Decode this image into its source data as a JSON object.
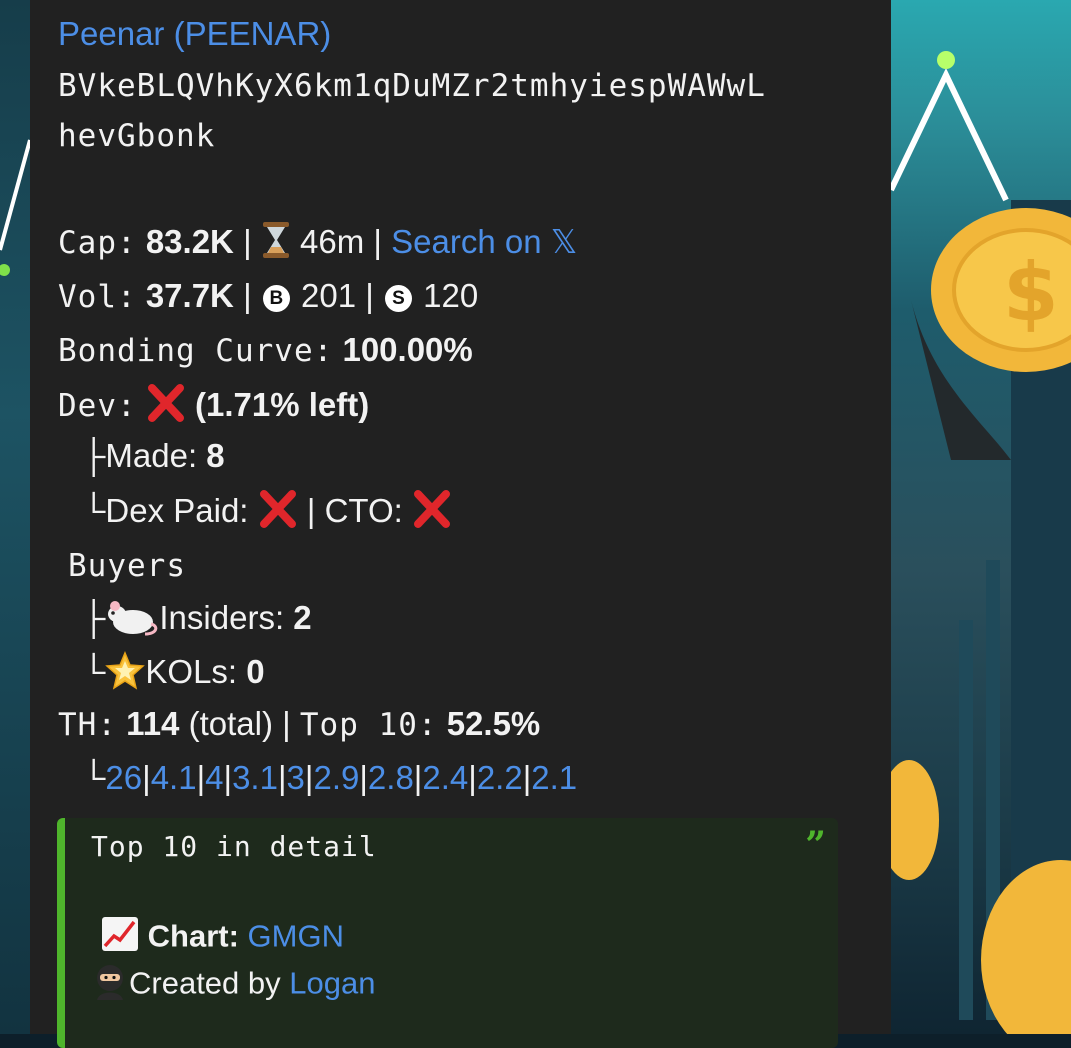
{
  "token": {
    "name": "Peenar (PEENAR)",
    "address_line1": "BVkeBLQVhKyX6km1qDuMZr2tmhyiespWAWwL",
    "address_line2": "hevGbonk"
  },
  "stats": {
    "cap_label": "Cap:",
    "cap_value": "83.2K",
    "sep": "|",
    "age": "46m",
    "search_link": "Search on 𝕏",
    "vol_label": "Vol:",
    "vol_value": "37.7K",
    "buys_badge": "B",
    "buys": "201",
    "sells_badge": "S",
    "sells": "120",
    "bonding_label": "Bonding Curve:",
    "bonding_value": "100.00%"
  },
  "dev": {
    "label": "Dev:",
    "left": "(1.71% left)",
    "made_prefix": "├",
    "made_label": "Made:",
    "made_value": "8",
    "dex_prefix": "└",
    "dex_label": "Dex Paid:",
    "cto_label": "CTO:"
  },
  "buyers": {
    "title": "Buyers",
    "insiders_prefix": "├",
    "insiders_label": "Insiders:",
    "insiders_value": "2",
    "kols_prefix": "└",
    "kols_label": "KOLs:",
    "kols_value": "0"
  },
  "holders": {
    "th_label": "TH:",
    "th_value": "114",
    "th_suffix": "(total)",
    "top10_label": "Top 10:",
    "top10_value": "52.5%",
    "list_prefix": "└",
    "list": [
      "26",
      "4.1",
      "4",
      "3.1",
      "3",
      "2.9",
      "2.8",
      "2.4",
      "2.2",
      "2.1"
    ]
  },
  "quote": {
    "mark": "”",
    "title": "Top 10 in detail",
    "chart_label": "Chart:",
    "chart_link": "GMGN",
    "created_label": "Created by",
    "created_link": "Logan"
  },
  "icons": {
    "hourglass": "hourglass-icon",
    "cross": "cross-mark-icon",
    "rat": "rat-icon",
    "star": "glowing-star-icon",
    "chart": "chart-increasing-icon",
    "ninja": "ninja-icon"
  },
  "colors": {
    "bubble": "#212121",
    "link": "#4c8ee6",
    "quote_bg": "#1e2a1c",
    "quote_accent": "#4fb52c",
    "cross": "#e0262b"
  }
}
